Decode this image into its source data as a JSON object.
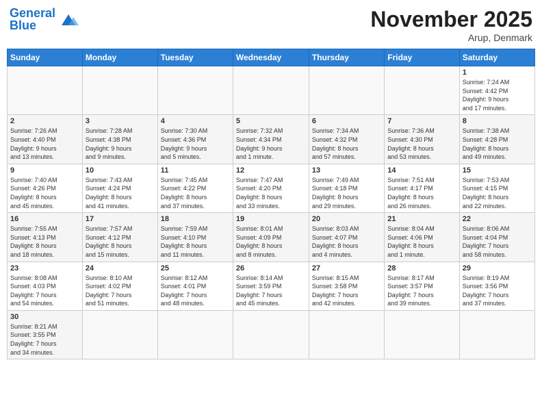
{
  "header": {
    "logo_text_general": "General",
    "logo_text_blue": "Blue",
    "title": "November 2025",
    "subtitle": "Arup, Denmark"
  },
  "weekdays": [
    "Sunday",
    "Monday",
    "Tuesday",
    "Wednesday",
    "Thursday",
    "Friday",
    "Saturday"
  ],
  "weeks": [
    [
      {
        "num": "",
        "info": ""
      },
      {
        "num": "",
        "info": ""
      },
      {
        "num": "",
        "info": ""
      },
      {
        "num": "",
        "info": ""
      },
      {
        "num": "",
        "info": ""
      },
      {
        "num": "",
        "info": ""
      },
      {
        "num": "1",
        "info": "Sunrise: 7:24 AM\nSunset: 4:42 PM\nDaylight: 9 hours\nand 17 minutes."
      }
    ],
    [
      {
        "num": "2",
        "info": "Sunrise: 7:26 AM\nSunset: 4:40 PM\nDaylight: 9 hours\nand 13 minutes."
      },
      {
        "num": "3",
        "info": "Sunrise: 7:28 AM\nSunset: 4:38 PM\nDaylight: 9 hours\nand 9 minutes."
      },
      {
        "num": "4",
        "info": "Sunrise: 7:30 AM\nSunset: 4:36 PM\nDaylight: 9 hours\nand 5 minutes."
      },
      {
        "num": "5",
        "info": "Sunrise: 7:32 AM\nSunset: 4:34 PM\nDaylight: 9 hours\nand 1 minute."
      },
      {
        "num": "6",
        "info": "Sunrise: 7:34 AM\nSunset: 4:32 PM\nDaylight: 8 hours\nand 57 minutes."
      },
      {
        "num": "7",
        "info": "Sunrise: 7:36 AM\nSunset: 4:30 PM\nDaylight: 8 hours\nand 53 minutes."
      },
      {
        "num": "8",
        "info": "Sunrise: 7:38 AM\nSunset: 4:28 PM\nDaylight: 8 hours\nand 49 minutes."
      }
    ],
    [
      {
        "num": "9",
        "info": "Sunrise: 7:40 AM\nSunset: 4:26 PM\nDaylight: 8 hours\nand 45 minutes."
      },
      {
        "num": "10",
        "info": "Sunrise: 7:43 AM\nSunset: 4:24 PM\nDaylight: 8 hours\nand 41 minutes."
      },
      {
        "num": "11",
        "info": "Sunrise: 7:45 AM\nSunset: 4:22 PM\nDaylight: 8 hours\nand 37 minutes."
      },
      {
        "num": "12",
        "info": "Sunrise: 7:47 AM\nSunset: 4:20 PM\nDaylight: 8 hours\nand 33 minutes."
      },
      {
        "num": "13",
        "info": "Sunrise: 7:49 AM\nSunset: 4:18 PM\nDaylight: 8 hours\nand 29 minutes."
      },
      {
        "num": "14",
        "info": "Sunrise: 7:51 AM\nSunset: 4:17 PM\nDaylight: 8 hours\nand 26 minutes."
      },
      {
        "num": "15",
        "info": "Sunrise: 7:53 AM\nSunset: 4:15 PM\nDaylight: 8 hours\nand 22 minutes."
      }
    ],
    [
      {
        "num": "16",
        "info": "Sunrise: 7:55 AM\nSunset: 4:13 PM\nDaylight: 8 hours\nand 18 minutes."
      },
      {
        "num": "17",
        "info": "Sunrise: 7:57 AM\nSunset: 4:12 PM\nDaylight: 8 hours\nand 15 minutes."
      },
      {
        "num": "18",
        "info": "Sunrise: 7:59 AM\nSunset: 4:10 PM\nDaylight: 8 hours\nand 11 minutes."
      },
      {
        "num": "19",
        "info": "Sunrise: 8:01 AM\nSunset: 4:09 PM\nDaylight: 8 hours\nand 8 minutes."
      },
      {
        "num": "20",
        "info": "Sunrise: 8:03 AM\nSunset: 4:07 PM\nDaylight: 8 hours\nand 4 minutes."
      },
      {
        "num": "21",
        "info": "Sunrise: 8:04 AM\nSunset: 4:06 PM\nDaylight: 8 hours\nand 1 minute."
      },
      {
        "num": "22",
        "info": "Sunrise: 8:06 AM\nSunset: 4:04 PM\nDaylight: 7 hours\nand 58 minutes."
      }
    ],
    [
      {
        "num": "23",
        "info": "Sunrise: 8:08 AM\nSunset: 4:03 PM\nDaylight: 7 hours\nand 54 minutes."
      },
      {
        "num": "24",
        "info": "Sunrise: 8:10 AM\nSunset: 4:02 PM\nDaylight: 7 hours\nand 51 minutes."
      },
      {
        "num": "25",
        "info": "Sunrise: 8:12 AM\nSunset: 4:01 PM\nDaylight: 7 hours\nand 48 minutes."
      },
      {
        "num": "26",
        "info": "Sunrise: 8:14 AM\nSunset: 3:59 PM\nDaylight: 7 hours\nand 45 minutes."
      },
      {
        "num": "27",
        "info": "Sunrise: 8:15 AM\nSunset: 3:58 PM\nDaylight: 7 hours\nand 42 minutes."
      },
      {
        "num": "28",
        "info": "Sunrise: 8:17 AM\nSunset: 3:57 PM\nDaylight: 7 hours\nand 39 minutes."
      },
      {
        "num": "29",
        "info": "Sunrise: 8:19 AM\nSunset: 3:56 PM\nDaylight: 7 hours\nand 37 minutes."
      }
    ],
    [
      {
        "num": "30",
        "info": "Sunrise: 8:21 AM\nSunset: 3:55 PM\nDaylight: 7 hours\nand 34 minutes."
      },
      {
        "num": "",
        "info": ""
      },
      {
        "num": "",
        "info": ""
      },
      {
        "num": "",
        "info": ""
      },
      {
        "num": "",
        "info": ""
      },
      {
        "num": "",
        "info": ""
      },
      {
        "num": "",
        "info": ""
      }
    ]
  ]
}
